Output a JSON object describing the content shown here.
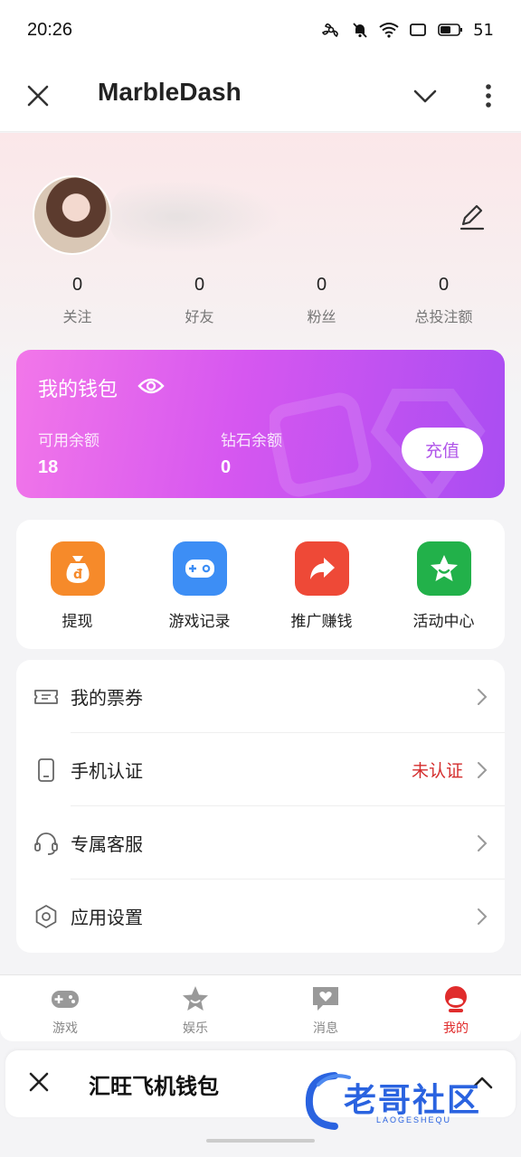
{
  "status_bar": {
    "time": "20:26",
    "battery": "51"
  },
  "app_bar": {
    "title": "MarbleDash"
  },
  "profile": {
    "stats": [
      {
        "value": "0",
        "label": "关注"
      },
      {
        "value": "0",
        "label": "好友"
      },
      {
        "value": "0",
        "label": "粉丝"
      },
      {
        "value": "0",
        "label": "总投注额"
      }
    ]
  },
  "wallet": {
    "title": "我的钱包",
    "available_label": "可用余额",
    "available_value": "18",
    "diamond_label": "钻石余额",
    "diamond_value": "0",
    "recharge_label": "充值"
  },
  "quick_actions": [
    {
      "label": "提现",
      "icon": "moneybag-icon",
      "color": "#f68a2a"
    },
    {
      "label": "游戏记录",
      "icon": "gamepad-icon",
      "color": "#3d8ef5"
    },
    {
      "label": "推广赚钱",
      "icon": "share-icon",
      "color": "#ee4937"
    },
    {
      "label": "活动中心",
      "icon": "star-icon",
      "color": "#22b14a"
    }
  ],
  "menu": [
    {
      "label": "我的票券",
      "icon": "ticket-icon",
      "status": ""
    },
    {
      "label": "手机认证",
      "icon": "phone-icon",
      "status": "未认证"
    },
    {
      "label": "专属客服",
      "icon": "headset-icon",
      "status": ""
    },
    {
      "label": "应用设置",
      "icon": "settings-icon",
      "status": ""
    }
  ],
  "tabs": [
    {
      "label": "游戏",
      "icon": "gamepad-icon"
    },
    {
      "label": "娱乐",
      "icon": "star-icon"
    },
    {
      "label": "消息",
      "icon": "message-icon"
    },
    {
      "label": "我的",
      "icon": "profile-icon"
    }
  ],
  "bottom_sheet": {
    "title": "汇旺飞机钱包"
  },
  "watermark": {
    "text": "老哥社区",
    "sub": "LAOGESHEQU"
  },
  "colors": {
    "accent_red": "#e02c2c",
    "wallet_start": "#f277e9",
    "wallet_end": "#a94df2",
    "unverified": "#d42d2d"
  }
}
